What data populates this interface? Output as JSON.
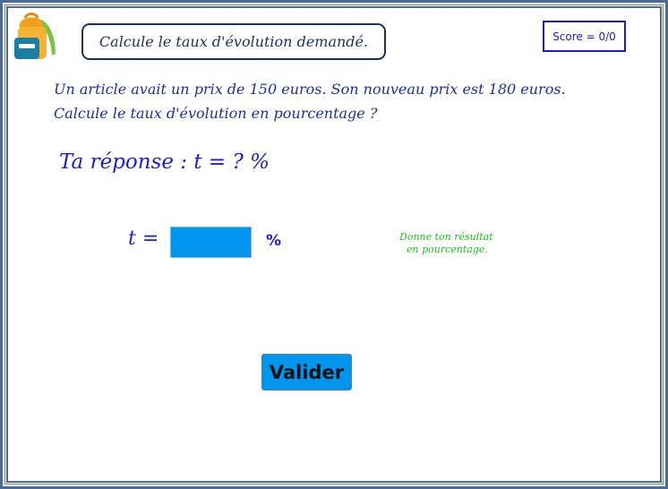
{
  "header": {
    "instruction": "Calcule le taux d'évolution demandé.",
    "score": "Score = 0/0",
    "logo_icon": "backpack-icon"
  },
  "problem": {
    "line1": "Un article avait un prix de 150 euros. Son nouveau prix est 180 euros.",
    "line2": "Calcule le taux d'évolution en pourcentage ?"
  },
  "answer": {
    "prompt": "Ta réponse :  t = ? %",
    "t_label": "t =",
    "input_value": "",
    "percent": "%",
    "hint_line1": "Donne ton résultat",
    "hint_line2": "en pourcentage.",
    "validate_label": "Valider"
  },
  "colors": {
    "accent_blue": "#0096f0",
    "text_blue": "#1c1cd1",
    "hint_green": "#20c020",
    "border": "#4a6b94"
  }
}
